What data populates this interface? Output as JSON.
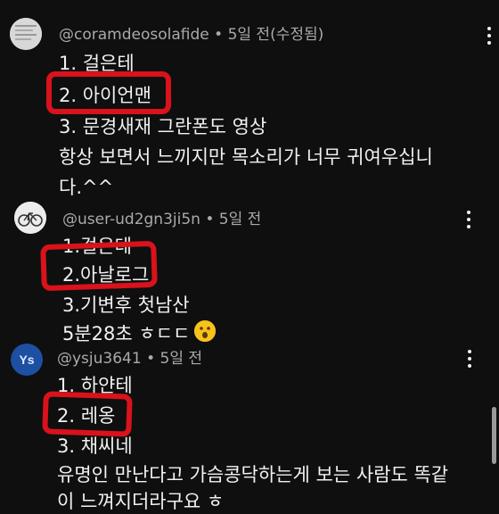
{
  "comments": [
    {
      "handle": "@coramdeosolafide",
      "time": "• 5일 전(수정됨)",
      "lines": [
        "1. 걸은테",
        "2. 아이언맨",
        "3. 문경새재 그란폰도 영상",
        "항상 보면서 느끼지만 목소리가 너무 귀여우십니",
        "다.^^"
      ]
    },
    {
      "handle": "@user-ud2gn3ji5n",
      "time": "• 5일 전",
      "lines": [
        "1.걸은테",
        "2.아날로그",
        "3.기변후 첫남산",
        "5분28초 ㅎㄷㄷ"
      ]
    },
    {
      "avatar_text": "Ys",
      "handle": "@ysju3641",
      "time": "• 5일 전",
      "lines": [
        "1. 하얀테",
        "2. 레옹",
        "3. 채씨네",
        "유명인 만난다고 가슴콩닥하는게 보는 사람도 똑같",
        "이 느껴지더라구요 ㅎ"
      ]
    }
  ],
  "icons": {
    "more": "vertical-ellipsis-icon",
    "emoji": "astonished-face-emoji",
    "avatar2": "bicycle-icon"
  },
  "colors": {
    "background": "#0f0f0f",
    "text": "#f1f1f1",
    "meta": "#aaaaaa",
    "highlight": "#d9121b",
    "ys_avatar": "#1d4fa3"
  }
}
